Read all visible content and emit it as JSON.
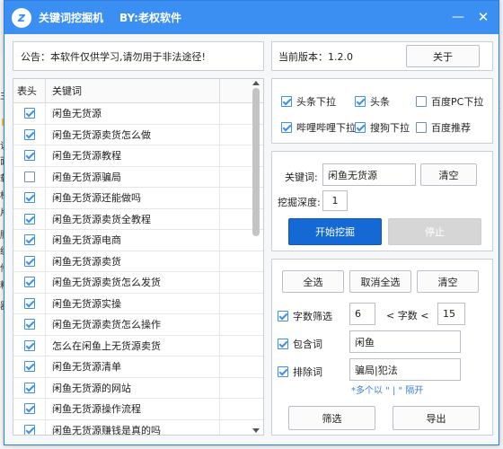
{
  "window": {
    "title": "关键词挖掘机",
    "author": "BY:老权软件",
    "minimize": "—",
    "close": "✕",
    "logo": "z"
  },
  "background": {
    "left_labels": [
      "主",
      "访",
      "面",
      "载",
      "档",
      "片",
      "脑",
      "统",
      "件",
      "料",
      "器"
    ],
    "right_label": "置"
  },
  "notice": {
    "text": "公告：本软件仅供学习,请勿用于非法途径!"
  },
  "version": {
    "text": "当前版本：1.2.0",
    "about_button": "关于"
  },
  "table": {
    "headers": [
      "表头",
      "关键词"
    ],
    "rows": [
      {
        "checked": true,
        "keyword": "闲鱼无货源"
      },
      {
        "checked": true,
        "keyword": "闲鱼无货源卖货怎么做"
      },
      {
        "checked": true,
        "keyword": "闲鱼无货源教程"
      },
      {
        "checked": false,
        "keyword": "闲鱼无货源骗局"
      },
      {
        "checked": true,
        "keyword": "闲鱼无货源还能做吗"
      },
      {
        "checked": true,
        "keyword": "闲鱼无货源卖货全教程"
      },
      {
        "checked": true,
        "keyword": "闲鱼无货源电商"
      },
      {
        "checked": true,
        "keyword": "闲鱼无货源卖货"
      },
      {
        "checked": true,
        "keyword": "闲鱼无货源卖货怎么发货"
      },
      {
        "checked": true,
        "keyword": "闲鱼无货源实操"
      },
      {
        "checked": true,
        "keyword": "闲鱼无货源卖货怎么操作"
      },
      {
        "checked": true,
        "keyword": "怎么在闲鱼上无货源卖货"
      },
      {
        "checked": true,
        "keyword": "闲鱼无货源清单"
      },
      {
        "checked": true,
        "keyword": "闲鱼无货源的网站"
      },
      {
        "checked": true,
        "keyword": "闲鱼无货源操作流程"
      },
      {
        "checked": true,
        "keyword": "闲鱼无货源赚钱是真的吗"
      }
    ]
  },
  "options": [
    {
      "label": "头条下拉",
      "checked": true
    },
    {
      "label": "头条",
      "checked": true
    },
    {
      "label": "百度PC下拉",
      "checked": false
    },
    {
      "label": "哔哩哔哩下拉",
      "checked": true
    },
    {
      "label": "搜狗下拉",
      "checked": true
    },
    {
      "label": "百度推荐",
      "checked": false
    }
  ],
  "keyword_panel": {
    "keyword_label": "关键词:",
    "keyword_value": "闲鱼无货源",
    "clear_button": "清空",
    "depth_label": "挖掘深度:",
    "depth_value": "1",
    "start_button": "开始挖掘",
    "stop_button": "停止"
  },
  "filter_panel": {
    "select_all": "全选",
    "deselect_all": "取消全选",
    "clear": "清空",
    "word_count_label": "字数筛选",
    "word_count_checked": true,
    "min_count": "6",
    "lt_label": "< 字数 <",
    "max_count": "15",
    "include_label": "包含词",
    "include_checked": true,
    "include_value": "闲鱼",
    "exclude_label": "排除词",
    "exclude_checked": true,
    "exclude_value": "骗局|犯法",
    "exclude_hint": "*多个以 \" | \" 隔开",
    "filter_button": "筛选",
    "export_button": "导出"
  },
  "colors": {
    "titlebar": "#3b8ff3",
    "primary_button": "#1469d4",
    "checkbox": "#3b8ff3",
    "hint": "#3b7fd4"
  }
}
